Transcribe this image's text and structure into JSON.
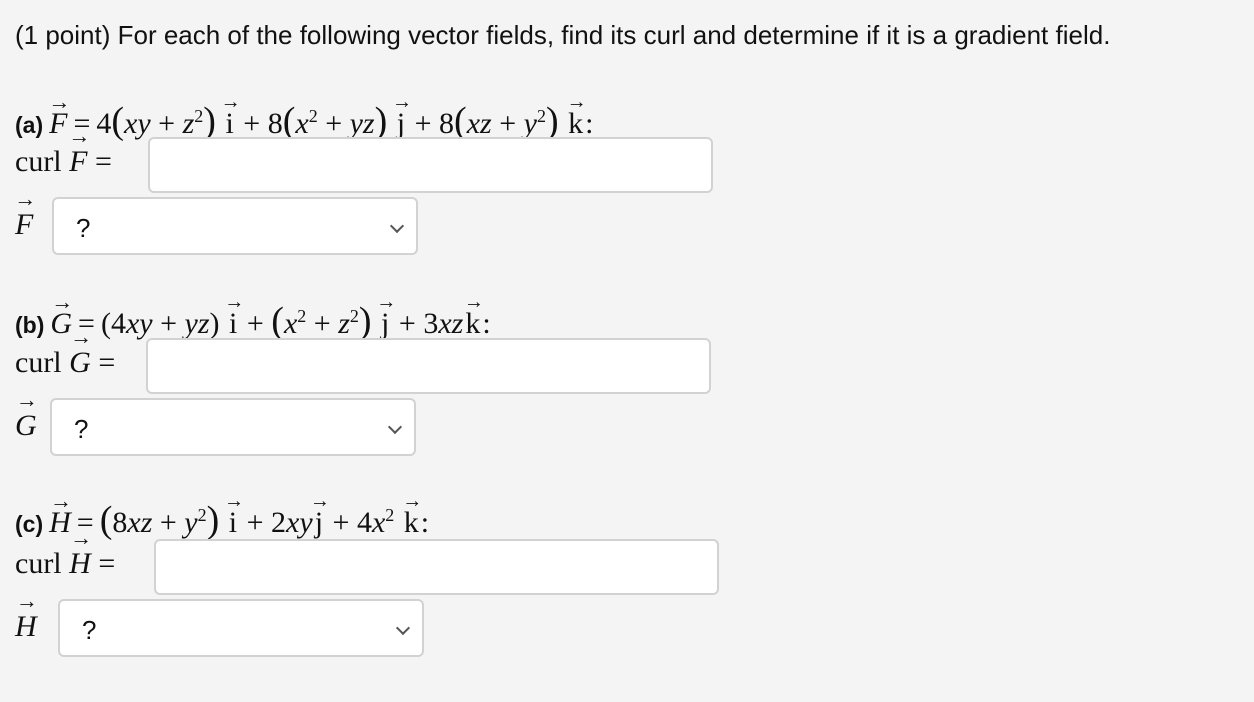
{
  "intro": "(1 point) For each of the following vector fields, find its curl and determine if it is a gradient field.",
  "parts": {
    "a": {
      "label": "(a)",
      "field_name": "F",
      "equals": "=",
      "curl_prefix": "curl",
      "curl_input_value": "",
      "select_value": "?",
      "term1_coef": "4",
      "term2_coef": "8",
      "term3_coef": "8"
    },
    "b": {
      "label": "(b)",
      "field_name": "G",
      "equals": "=",
      "curl_prefix": "curl",
      "curl_input_value": "",
      "select_value": "?",
      "term3_coef": "3"
    },
    "c": {
      "label": "(c)",
      "field_name": "H",
      "equals": "=",
      "curl_prefix": "curl",
      "curl_input_value": "",
      "select_value": "?",
      "term1_coef": "8",
      "term2_coef": "2",
      "term3_coef": "4"
    }
  },
  "unit_vectors": {
    "i": "i",
    "j": "j",
    "k": "k"
  }
}
